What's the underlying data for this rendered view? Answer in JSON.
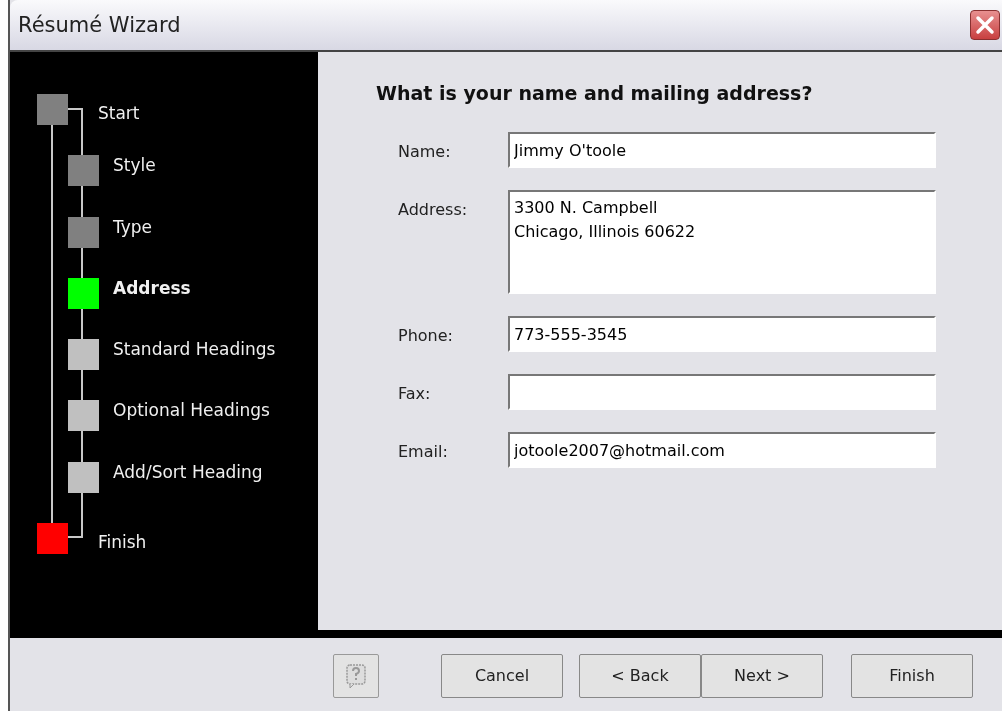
{
  "window": {
    "title": "Résumé Wizard"
  },
  "steps": [
    {
      "label": "Start",
      "kind": "terminal",
      "color": "#808080",
      "selected": false
    },
    {
      "label": "Style",
      "kind": "step",
      "color": "#808080",
      "selected": false
    },
    {
      "label": "Type",
      "kind": "step",
      "color": "#808080",
      "selected": false
    },
    {
      "label": "Address",
      "kind": "step",
      "color": "#00ff00",
      "selected": true
    },
    {
      "label": "Standard Headings",
      "kind": "step",
      "color": "#c0c0c0",
      "selected": false
    },
    {
      "label": "Optional Headings",
      "kind": "step",
      "color": "#c0c0c0",
      "selected": false
    },
    {
      "label": "Add/Sort Heading",
      "kind": "step",
      "color": "#c0c0c0",
      "selected": false
    },
    {
      "label": "Finish",
      "kind": "terminal",
      "color": "#ff0000",
      "selected": false
    }
  ],
  "heading": "What is your name and mailing address?",
  "fields": [
    {
      "label": "Name:",
      "kind": "line",
      "value": "Jimmy O'toole"
    },
    {
      "label": "Address:",
      "kind": "multiline",
      "value": "3300 N. Campbell\nChicago, Illinois 60622"
    },
    {
      "label": "Phone:",
      "kind": "line",
      "value": "773-555-3545"
    },
    {
      "label": "Fax:",
      "kind": "line"
    },
    {
      "label": "Email:",
      "kind": "line",
      "value": "jotoole2007@hotmail.com"
    }
  ],
  "buttons": [
    {
      "label": "Cancel"
    },
    {
      "label": "< Back"
    },
    {
      "label": "Next >"
    },
    {
      "label": "Finish"
    }
  ]
}
